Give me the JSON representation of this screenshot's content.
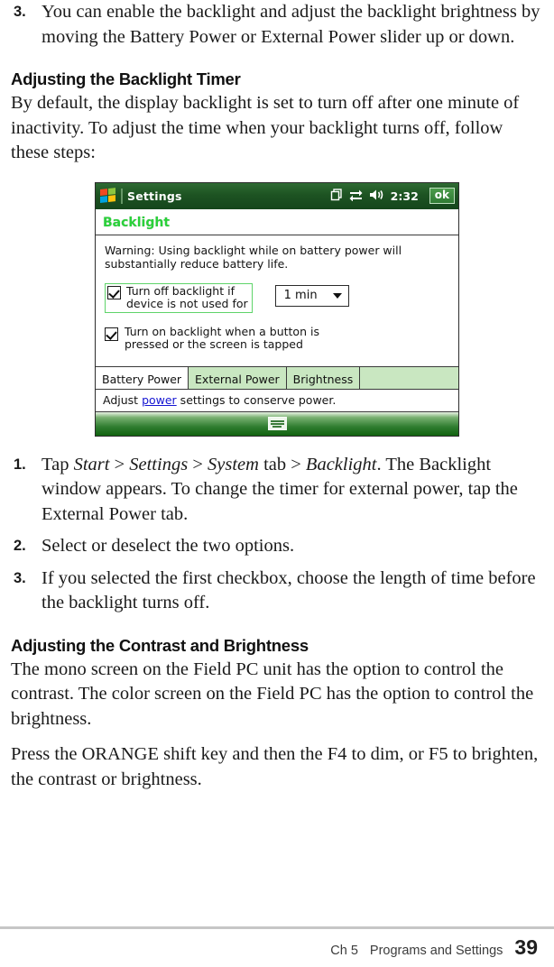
{
  "intro_step": {
    "number": "3.",
    "text": "You can enable the backlight and adjust the backlight brightness by moving the Battery Power or External Power slider up or down."
  },
  "section_timer": {
    "heading": "Adjusting the Backlight Timer",
    "paragraph": "By default, the display backlight is set to turn off after one minute of inactivity. To adjust the time when your backlight turns off, follow these steps:"
  },
  "device_screenshot": {
    "titlebar": {
      "app_title": "Settings",
      "time": "2:32",
      "ok_label": "ok",
      "icons": [
        "windows-flag-icon",
        "copy-icon",
        "connectivity-icon",
        "volume-icon"
      ]
    },
    "page_title": "Backlight",
    "warning": "Warning: Using backlight while on battery power will substantially reduce battery life.",
    "options": [
      {
        "label_line1": "Turn off backlight if",
        "label_line2": "device is not used for",
        "checked": true,
        "focused": true
      },
      {
        "label_line1": "Turn on backlight when a button is",
        "label_line2": "pressed or the screen is tapped",
        "checked": true,
        "focused": false
      }
    ],
    "timeout_dropdown": {
      "value": "1 min"
    },
    "tabs": [
      {
        "label": "Battery Power",
        "active": true
      },
      {
        "label": "External Power",
        "active": false
      },
      {
        "label": "Brightness",
        "active": false
      }
    ],
    "adjust_bar": {
      "prefix": "Adjust ",
      "link": "power",
      "suffix": " settings to conserve power."
    },
    "colors": {
      "titlebar_green": "#1d5322",
      "page_title_green": "#2ad13a",
      "tab_inactive": "#c9e7c1",
      "focus_green": "#5fd46a",
      "link_blue": "#1414d2"
    }
  },
  "steps": [
    {
      "number": "1.",
      "segments": [
        {
          "text": "Tap ",
          "style": "normal"
        },
        {
          "text": "Start",
          "style": "italic"
        },
        {
          "text": " > ",
          "style": "normal"
        },
        {
          "text": "Settings",
          "style": "italic"
        },
        {
          "text": " > ",
          "style": "normal"
        },
        {
          "text": "System",
          "style": "italic"
        },
        {
          "text": " tab > ",
          "style": "normal"
        },
        {
          "text": "Backlight",
          "style": "italic"
        },
        {
          "text": ". The Backlight window appears. To change the timer for external power, tap the External Power tab.",
          "style": "normal"
        }
      ]
    },
    {
      "number": "2.",
      "segments": [
        {
          "text": "Select or deselect the two options.",
          "style": "normal"
        }
      ]
    },
    {
      "number": "3.",
      "segments": [
        {
          "text": "If you selected the first checkbox, choose the length of time before the backlight turns off.",
          "style": "normal"
        }
      ]
    }
  ],
  "section_contrast": {
    "heading": "Adjusting the Contrast and Brightness",
    "paragraph1": "The mono screen on the Field PC unit has the option to control the contrast. The color screen on the Field PC has the option to control the brightness.",
    "paragraph2": "Press the ORANGE shift key and then the F4 to dim, or F5 to brighten, the contrast or brightness."
  },
  "footer": {
    "chapter": "Ch 5",
    "section": "Programs and Settings",
    "page_number": "39"
  }
}
